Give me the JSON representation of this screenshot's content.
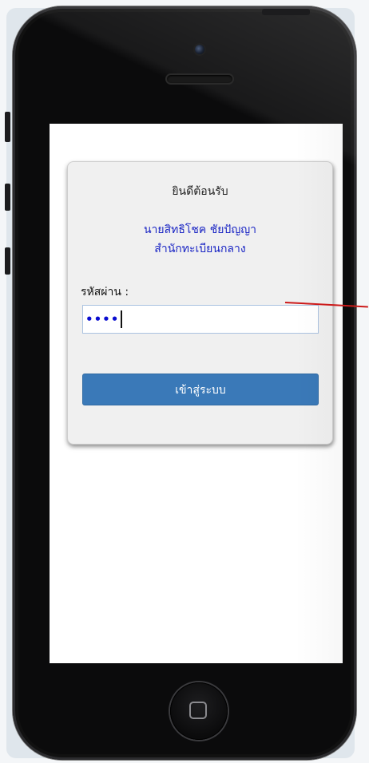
{
  "login": {
    "welcome": "ยินดีต้อนรับ",
    "user_name": "นายสิทธิโชค ชัยปัญญา",
    "office": "สำนักทะเบียนกลาง",
    "password_label": "รหัสผ่าน :",
    "password_masked": "••••",
    "submit_label": "เข้าสู่ระบบ"
  },
  "colors": {
    "accent_text": "#1a25c4",
    "button": "#3a79b8",
    "pointer_line": "#cc1a1a"
  },
  "icons": {
    "home": "home-square-icon",
    "camera": "camera-icon"
  }
}
